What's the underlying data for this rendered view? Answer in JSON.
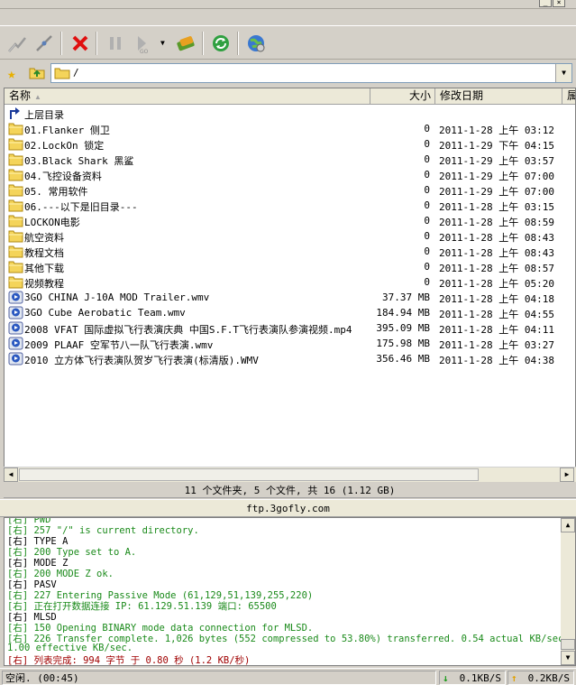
{
  "toolbar": {
    "buttons": [
      "connect-icon",
      "disconnect-icon",
      "stop-icon",
      "pause-icon",
      "transfer-icon",
      "sync-icon",
      "refresh-icon",
      "globe-icon"
    ]
  },
  "address": {
    "path": "/"
  },
  "columns": {
    "name": "名称",
    "size": "大小",
    "date": "修改日期",
    "extra": "属"
  },
  "files": [
    {
      "name": "上层目录",
      "size": "",
      "date": "",
      "type": "up"
    },
    {
      "name": "01.Flanker 侧卫",
      "size": "0",
      "date": "2011-1-28 上午 03:12",
      "type": "folder"
    },
    {
      "name": "02.LockOn 锁定",
      "size": "0",
      "date": "2011-1-29 下午 04:15",
      "type": "folder"
    },
    {
      "name": "03.Black Shark 黑鲨",
      "size": "0",
      "date": "2011-1-29 上午 03:57",
      "type": "folder"
    },
    {
      "name": "04.飞控设备资料",
      "size": "0",
      "date": "2011-1-29 上午 07:00",
      "type": "folder"
    },
    {
      "name": "05. 常用软件",
      "size": "0",
      "date": "2011-1-29 上午 07:00",
      "type": "folder"
    },
    {
      "name": "06.---以下是旧目录---",
      "size": "0",
      "date": "2011-1-28 上午 03:15",
      "type": "folder"
    },
    {
      "name": "LOCKON电影",
      "size": "0",
      "date": "2011-1-28 上午 08:59",
      "type": "folder"
    },
    {
      "name": "航空资料",
      "size": "0",
      "date": "2011-1-28 上午 08:43",
      "type": "folder"
    },
    {
      "name": "教程文档",
      "size": "0",
      "date": "2011-1-28 上午 08:43",
      "type": "folder"
    },
    {
      "name": "其他下载",
      "size": "0",
      "date": "2011-1-28 上午 08:57",
      "type": "folder"
    },
    {
      "name": "视频教程",
      "size": "0",
      "date": "2011-1-28 上午 05:20",
      "type": "folder"
    },
    {
      "name": "3GO CHINA J-10A MOD Trailer.wmv",
      "size": "37.37 MB",
      "date": "2011-1-28 上午 04:18",
      "type": "video"
    },
    {
      "name": "3GO Cube Aerobatic Team.wmv",
      "size": "184.94 MB",
      "date": "2011-1-28 上午 04:55",
      "type": "video"
    },
    {
      "name": "2008 VFAT 国际虚拟飞行表演庆典 中国S.F.T飞行表演队参演视频.mp4",
      "size": "395.09 MB",
      "date": "2011-1-28 上午 04:11",
      "type": "video"
    },
    {
      "name": "2009 PLAAF 空军节八一队飞行表演.wmv",
      "size": "175.98 MB",
      "date": "2011-1-28 上午 03:27",
      "type": "video"
    },
    {
      "name": "2010 立方体飞行表演队贺岁飞行表演(标清版).WMV",
      "size": "356.46 MB",
      "date": "2011-1-28 上午 04:38",
      "type": "video"
    }
  ],
  "summary": "11 个文件夹, 5 个文件, 共 16 (1.12 GB)",
  "server": "ftp.3gofly.com",
  "log": [
    {
      "text": "[右] 257 \"/\" is current directory.",
      "color": "green"
    },
    {
      "text": "[右] TYPE A",
      "color": "black"
    },
    {
      "text": "[右] 200 Type set to A.",
      "color": "green"
    },
    {
      "text": "[右] MODE Z",
      "color": "black"
    },
    {
      "text": "[右] 200 MODE Z ok.",
      "color": "green"
    },
    {
      "text": "[右] PASV",
      "color": "black"
    },
    {
      "text": "[右] 227 Entering Passive Mode (61,129,51,139,255,220)",
      "color": "green"
    },
    {
      "text": "[右] 正在打开数据连接 IP: 61.129.51.139 端口: 65500",
      "color": "green"
    },
    {
      "text": "[右] MLSD",
      "color": "black"
    },
    {
      "text": "[右] 150 Opening BINARY mode data connection for MLSD.",
      "color": "green"
    },
    {
      "text": "[右] 226 Transfer complete. 1,026 bytes (552 compressed to 53.80%) transferred. 0.54 actual KB/sec,",
      "color": "green"
    },
    {
      "text": "1.00 effective KB/sec.",
      "color": "green"
    },
    {
      "text": "[右] 列表完成: 994 字节 于 0.80 秒 (1.2 KB/秒)",
      "color": "red"
    }
  ],
  "footer": {
    "status": "空闲. (00:45)",
    "down_speed": "0.1KB/S",
    "up_speed": "0.2KB/S"
  }
}
